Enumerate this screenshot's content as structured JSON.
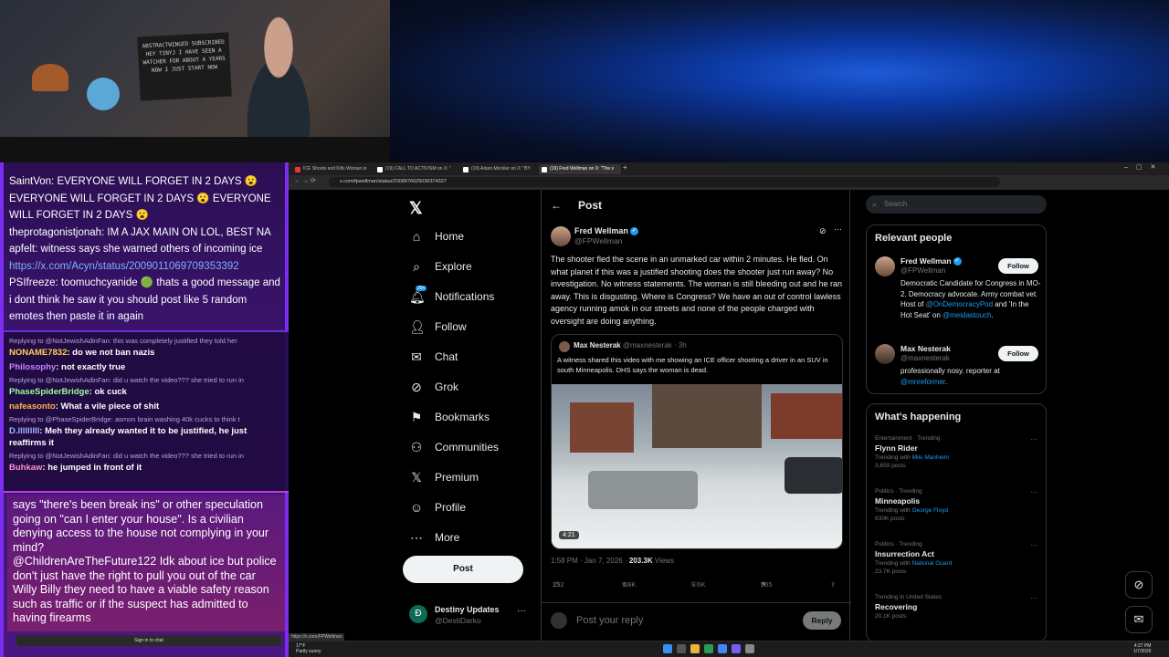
{
  "stream_chat": {
    "top_messages": [
      {
        "user": "SaintVon",
        "text": "EVERYONE WILL FORGET IN 2 DAYS 😮 EVERYONE WILL FORGET IN 2 DAYS 😮 EVERYONE WILL FORGET IN 2 DAYS 😮"
      },
      {
        "user": "theprotagonistjonah",
        "text": "IM A JAX MAIN ON LOL, BEST NA"
      },
      {
        "user": "apfelt",
        "text": "witness says she warned others of incoming ice"
      },
      {
        "user": "",
        "text": "https://x.com/Acyn/status/2009011069709353392"
      },
      {
        "user": "PSIfreeze",
        "text": "toomuchcyanide 🟢 thats a good message and i dont think he saw it you should post like 5 random emotes then paste it in again"
      }
    ],
    "yt_messages": [
      {
        "reply_to": "Replying to @NotJewishAdinFan: this was completely justified they told her",
        "user": "NONAME7832",
        "text": "do we not ban nazis"
      },
      {
        "reply_to": "",
        "user": "Philosophy",
        "text": "not exactly true"
      },
      {
        "reply_to": "Replying to @NotJewishAdinFan: did u watch the video??? she tried to run in",
        "user": "PhaseSpiderBridge",
        "text": "ok cuck"
      },
      {
        "reply_to": "",
        "user": "nafeasonto",
        "text": "What a vile piece of shit"
      },
      {
        "reply_to": "Replying to @PhaseSpiderBridge: asmon brain washing 40k cucks to think t",
        "user": "D.lllllllll",
        "text": "Meh they already wanted it to be justified, he just reaffirms it"
      },
      {
        "reply_to": "Replying to @NotJewishAdinFan: did u watch the video??? she tried to run in",
        "user": "Buhkaw",
        "text": "he jumped in front of it"
      }
    ],
    "bottom_text": "says \"there's been break ins\" or other speculation going on \"can I enter your house\". Is a civilian denying access to the house not complying in your mind?",
    "bottom_user": "@ChildrenAreTheFuture122",
    "bottom_user_text": "Idk about ice but police don't just have the right to pull you out of the car Willy Billy they need to have a viable safety reason such as traffic or if the suspect has admitted to having firearms",
    "sign_in_label": "Sign in to chat"
  },
  "webcam": {
    "sign_text": "ABSTRACTWINGED SUBSCRIBED HEY TINYJ I HAVE SEEN A WATCHER FOR ABOUT A YEARS NOW I JUST START NOW"
  },
  "browser": {
    "tabs": [
      {
        "label": "ICE Shoots and Kills Woman in"
      },
      {
        "label": "(19) CALL TO ACTIVISM on X: \""
      },
      {
        "label": "(19) Adam Mockler on X: \"BY"
      },
      {
        "label": "(19) Fred Wellman on X: \"The s"
      }
    ],
    "address": "x.com/fpwellman/status/2008976625036374327",
    "status_url": "https://x.com/FPWellman"
  },
  "x_nav": {
    "items": [
      {
        "label": "Home",
        "icon": "home-icon"
      },
      {
        "label": "Explore",
        "icon": "search-icon"
      },
      {
        "label": "Notifications",
        "icon": "bell-icon",
        "badge": "20+"
      },
      {
        "label": "Follow",
        "icon": "person-add-icon"
      },
      {
        "label": "Chat",
        "icon": "mail-icon"
      },
      {
        "label": "Grok",
        "icon": "grok-icon"
      },
      {
        "label": "Bookmarks",
        "icon": "bookmark-icon"
      },
      {
        "label": "Communities",
        "icon": "communities-icon"
      },
      {
        "label": "Premium",
        "icon": "x-icon"
      },
      {
        "label": "Profile",
        "icon": "person-icon"
      },
      {
        "label": "More",
        "icon": "more-icon"
      }
    ],
    "post_button": "Post",
    "account": {
      "name": "Destiny Updates",
      "handle": "@DestiDarko"
    }
  },
  "post": {
    "header": "Post",
    "author": "Fred Wellman",
    "handle": "@FPWellman",
    "text": "The shooter fled the scene in an unmarked car within 2 minutes. He fled. On what planet if this was a justified shooting does the shooter just run away? No investigation. No witness statements. The woman is still bleeding out and he ran away. This is disgusting. Where is Congress? We have an out of control lawless agency running amok in our streets and none of the people charged with oversight are doing anything.",
    "quote": {
      "author": "Max Nesterak",
      "handle": "@maxnesterak",
      "time": "· 3h",
      "text": "A witness shared this video with me showing an ICE officer shooting a driver in an SUV in south Minneapolis. DHS says the woman is dead.",
      "duration": "4:21"
    },
    "timestamp": "1:58 PM · Jan 7, 2026 ·",
    "views_count": "203.3K",
    "views_label": "Views",
    "replies": "252",
    "reposts": "3.8K",
    "likes": "9.6K",
    "bookmarks": "505",
    "reply_placeholder": "Post your reply",
    "reply_button": "Reply"
  },
  "sidebar": {
    "search_placeholder": "Search",
    "relevant_title": "Relevant people",
    "people": [
      {
        "name": "Fred Wellman",
        "handle": "@FPWellman",
        "bio_pre": "Democratic Candidate for Congress in MO-2. Democracy advocate. Army combat vet. Host of ",
        "bio_link1": "@OnDemocracyPod",
        "bio_mid": " and 'In the Hot Seat' on ",
        "bio_link2": "@meidastouch",
        "bio_post": ".",
        "follow": "Follow"
      },
      {
        "name": "Max Nesterak",
        "handle": "@maxnesterak",
        "bio_pre": "professionally nosy. reporter at ",
        "bio_link1": "@mnreformer",
        "bio_post": ".",
        "follow": "Follow"
      }
    ],
    "happening_title": "What's happening",
    "trends": [
      {
        "category": "Entertainment · Trending",
        "title": "Flynn Rider",
        "with_label": "Trending with",
        "with": "Milo Manheim",
        "posts": "3,659 posts"
      },
      {
        "category": "Politics · Trending",
        "title": "Minneapolis",
        "with_label": "Trending with",
        "with": "George Floyd",
        "posts": "630K posts"
      },
      {
        "category": "Politics · Trending",
        "title": "Insurrection Act",
        "with_label": "Trending with",
        "with": "National Guard",
        "posts": "23.7K posts"
      },
      {
        "category": "Trending in United States",
        "title": "Recovering",
        "with_label": "",
        "with": "",
        "posts": "20.1K posts"
      }
    ]
  },
  "taskbar": {
    "weather_temp": "17°F",
    "weather_desc": "Partly sunny",
    "time": "4:27 PM",
    "date": "1/7/2026"
  },
  "colors": {
    "x_blue": "#1d9bf0",
    "chat_purple": "#7b2df0",
    "background": "#000000"
  }
}
